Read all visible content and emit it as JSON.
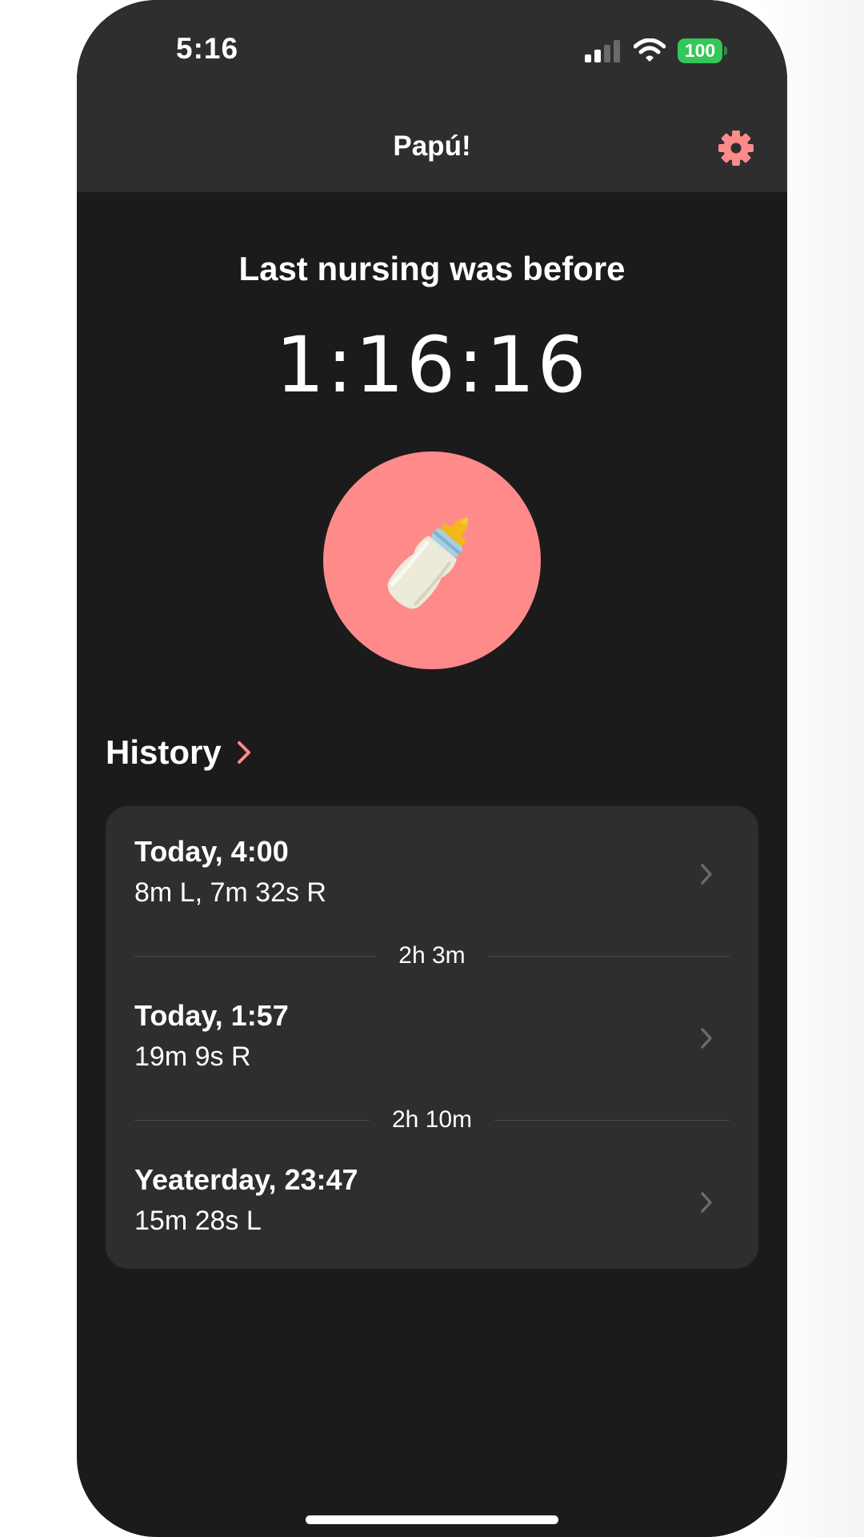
{
  "status_bar": {
    "time": "5:16",
    "battery": "100",
    "icons": [
      "signal-icon",
      "wifi-icon",
      "battery-icon"
    ]
  },
  "nav": {
    "title": "Papú!",
    "settings_icon": "gear-icon"
  },
  "main": {
    "headline": "Last nursing was before",
    "timer": "1:16:16",
    "button_icon": "baby-bottle-icon"
  },
  "history": {
    "title": "History",
    "entries": [
      {
        "title": "Today, 4:00",
        "detail": "8m L, 7m 32s R"
      },
      {
        "title": "Today, 1:57",
        "detail": "19m 9s R"
      },
      {
        "title": "Yeaterday, 23:47",
        "detail": "15m 28s L"
      }
    ],
    "gaps": [
      "2h 3m",
      "2h 10m"
    ]
  },
  "colors": {
    "accent": "#ff8a8a",
    "background": "#1b1b1b",
    "surface": "#2e2e2f",
    "battery": "#34c759"
  }
}
